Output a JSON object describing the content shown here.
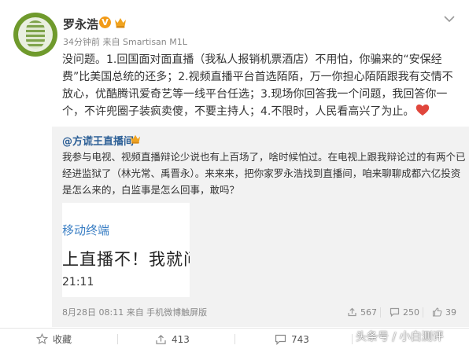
{
  "post": {
    "username": "罗永浩",
    "verified_badge": "V",
    "meta": "34分钟前 来自 Smartisan M1L",
    "body_lines": [
      "没问题。1.回国面对面直播（我私人报销机票酒店）不用怕，你骗来的“安保经",
      "费”比美国总统的还多；2.视频直播平台首选陌陌，万一你担心陌陌跟我有交情不",
      "放心，优酷腾讯爱奇艺等一线平台任选；3.现场你回答我一个问题，我回答你一",
      "个，不许兜圈子装疯卖傻，不要主持人；4.不限时，人民看高兴了为止。"
    ],
    "icons": [
      "avatar",
      "verified-badge",
      "crown-icon",
      "chevron-down-icon",
      "heart-emoji"
    ]
  },
  "repost": {
    "author": "@方谎王直播间",
    "text_lines": [
      "我参与电视、视频直播辩论少说也有上百场了，啥时候怕过。在电视上跟我辩论过的有两个已",
      "经进监狱了（林光常、禹晋永）。来来来，把你家罗永浩找到直播间，咱来聊聊成都六亿投资",
      "是怎么来的，白监事是怎么回事，敢吗？"
    ],
    "thumbnail": {
      "line1": "移动终端",
      "line2": "上直播不！我就问",
      "line3": "21:11"
    },
    "time": "8月28日 08:11 来自 手机微博触屏版",
    "reposts": "567",
    "comments": "250",
    "likes": "39"
  },
  "actions": {
    "favorite": "收藏",
    "repost": "413",
    "comment": "743"
  },
  "watermark": "头条号 / 小白测评",
  "colors": {
    "link": "#2c5f96",
    "badge": "#f29b18",
    "crown": "#f0a31e",
    "heart": "#e0463c",
    "repost_bg": "#f2f2f2"
  }
}
